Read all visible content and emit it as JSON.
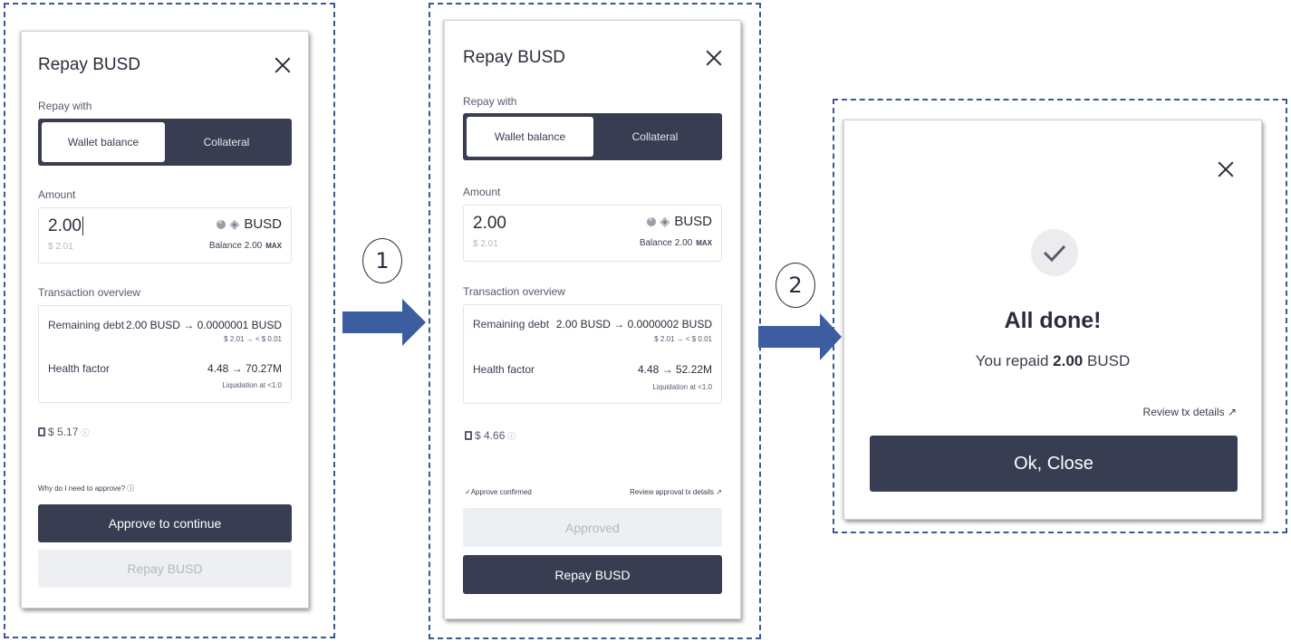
{
  "steps": [
    "1",
    "2"
  ],
  "modal1": {
    "title": "Repay BUSD",
    "repay_with_label": "Repay with",
    "tab_wallet": "Wallet balance",
    "tab_collateral": "Collateral",
    "amount_label": "Amount",
    "amount_value": "2.00",
    "amount_usd": "$ 2.01",
    "asset_symbol": "BUSD",
    "balance_text": "Balance 2.00",
    "max_label": "MAX",
    "overview_label": "Transaction overview",
    "remaining_debt_label": "Remaining debt",
    "remaining_debt_value": "2.00 BUSD → 0.0000001 BUSD",
    "remaining_debt_usd": "$ 2.01 → < $ 0.01",
    "health_factor_label": "Health factor",
    "health_factor_value": "4.48 → 70.27M",
    "liquidation_note": "Liquidation at <1.0",
    "gas_cost": "$ 5.17",
    "approve_question": "Why do I need to approve?",
    "approve_button": "Approve to continue",
    "repay_button": "Repay BUSD"
  },
  "modal2": {
    "title": "Repay BUSD",
    "repay_with_label": "Repay with",
    "tab_wallet": "Wallet balance",
    "tab_collateral": "Collateral",
    "amount_label": "Amount",
    "amount_value": "2.00",
    "amount_usd": "$ 2.01",
    "asset_symbol": "BUSD",
    "balance_text": "Balance 2.00",
    "max_label": "MAX",
    "overview_label": "Transaction overview",
    "remaining_debt_label": "Remaining debt",
    "remaining_debt_value": "2.00 BUSD → 0.0000002 BUSD",
    "remaining_debt_usd": "$ 2.01 → < $ 0.01",
    "health_factor_label": "Health factor",
    "health_factor_value": "4.48 → 52.22M",
    "liquidation_note": "Liquidation at <1.0",
    "gas_cost": "$ 4.66",
    "approve_confirmed": "✓Approve confirmed",
    "review_approval": "Review approval tx details",
    "approved_button": "Approved",
    "repay_button": "Repay BUSD"
  },
  "modal3": {
    "heading": "All done!",
    "repaid_prefix": "You repaid",
    "repaid_amount": "2.00",
    "repaid_asset": "BUSD",
    "review_link": "Review tx details",
    "close_button": "Ok, Close"
  },
  "colors": {
    "dark": "#383d51",
    "dashed_border": "#3b5a8f",
    "arrow": "#3c5ea0"
  }
}
